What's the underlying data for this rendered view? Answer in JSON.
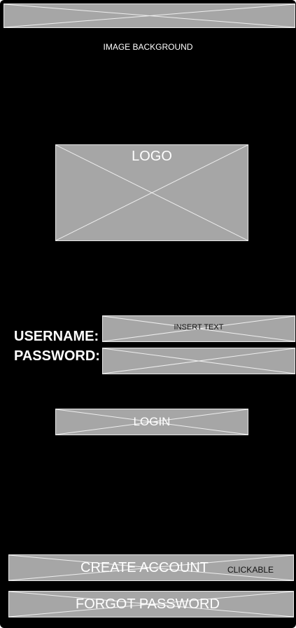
{
  "top_bar": {
    "icon": "image-placeholder-icon"
  },
  "background": {
    "label": "IMAGE BACKGROUND"
  },
  "logo": {
    "label": "LOGO"
  },
  "form": {
    "username_label": "USERNAME:",
    "username_placeholder": "INSERT TEXT",
    "password_label": "PASSWORD:",
    "password_placeholder": ""
  },
  "login_button": {
    "label": "LOGIN"
  },
  "create_account_button": {
    "label": "CREATE ACCOUNT",
    "note": "CLICKABLE"
  },
  "forgot_password_button": {
    "label": "FORGOT PASSWORD"
  },
  "colors": {
    "background": "#000000",
    "placeholder_fill": "#a6a6a6",
    "placeholder_stroke": "#e8e8e8",
    "text": "#ffffff"
  }
}
